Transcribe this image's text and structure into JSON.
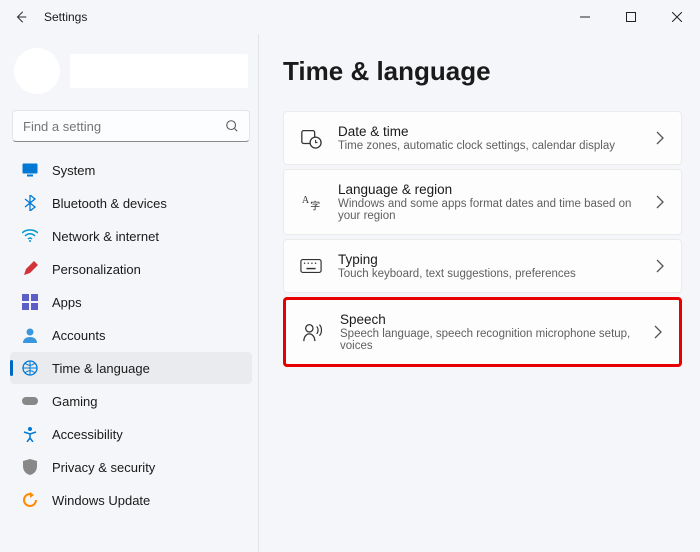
{
  "window": {
    "title": "Settings"
  },
  "search": {
    "placeholder": "Find a setting"
  },
  "nav": [
    {
      "label": "System"
    },
    {
      "label": "Bluetooth & devices"
    },
    {
      "label": "Network & internet"
    },
    {
      "label": "Personalization"
    },
    {
      "label": "Apps"
    },
    {
      "label": "Accounts"
    },
    {
      "label": "Time & language"
    },
    {
      "label": "Gaming"
    },
    {
      "label": "Accessibility"
    },
    {
      "label": "Privacy & security"
    },
    {
      "label": "Windows Update"
    }
  ],
  "page": {
    "heading": "Time & language"
  },
  "cards": [
    {
      "title": "Date & time",
      "sub": "Time zones, automatic clock settings, calendar display"
    },
    {
      "title": "Language & region",
      "sub": "Windows and some apps format dates and time based on your region"
    },
    {
      "title": "Typing",
      "sub": "Touch keyboard, text suggestions, preferences"
    },
    {
      "title": "Speech",
      "sub": "Speech language, speech recognition microphone setup, voices"
    }
  ]
}
